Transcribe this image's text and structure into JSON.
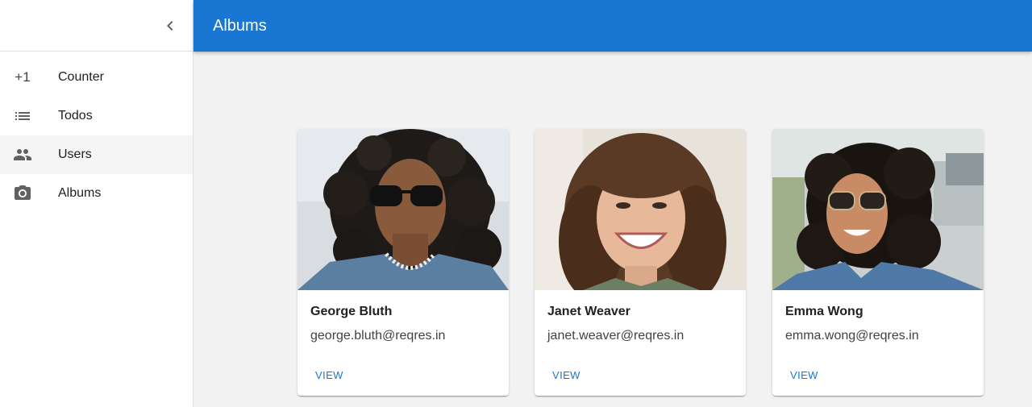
{
  "appbar": {
    "title": "Albums"
  },
  "drawer": {
    "collapse_icon": "chevron-left-icon",
    "items": [
      {
        "label": "Counter",
        "icon": "plus-one-icon",
        "icon_text": "+1",
        "active": false
      },
      {
        "label": "Todos",
        "icon": "list-icon",
        "active": false
      },
      {
        "label": "Users",
        "icon": "people-icon",
        "active": true
      },
      {
        "label": "Albums",
        "icon": "camera-icon",
        "active": false
      }
    ]
  },
  "users": [
    {
      "name": "George Bluth",
      "email": "george.bluth@reqres.in",
      "action": "VIEW"
    },
    {
      "name": "Janet Weaver",
      "email": "janet.weaver@reqres.in",
      "action": "VIEW"
    },
    {
      "name": "Emma Wong",
      "email": "emma.wong@reqres.in",
      "action": "VIEW"
    }
  ],
  "colors": {
    "primary": "#1976d2",
    "active_item_bg": "#f5f5f5",
    "page_bg": "#f2f2f2"
  }
}
